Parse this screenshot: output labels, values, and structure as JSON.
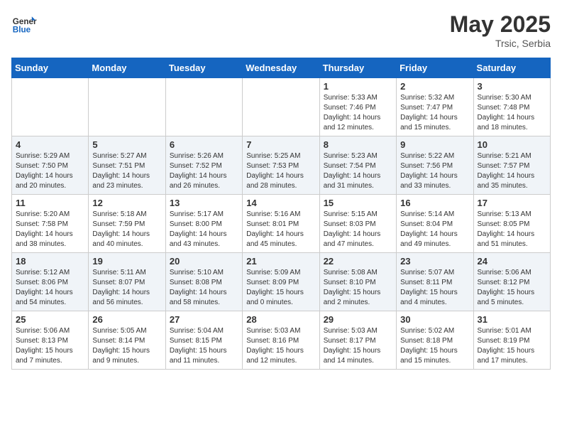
{
  "header": {
    "logo_line1": "General",
    "logo_line2": "Blue",
    "month_year": "May 2025",
    "location": "Trsic, Serbia"
  },
  "days_of_week": [
    "Sunday",
    "Monday",
    "Tuesday",
    "Wednesday",
    "Thursday",
    "Friday",
    "Saturday"
  ],
  "weeks": [
    [
      {
        "day": "",
        "info": ""
      },
      {
        "day": "",
        "info": ""
      },
      {
        "day": "",
        "info": ""
      },
      {
        "day": "",
        "info": ""
      },
      {
        "day": "1",
        "info": "Sunrise: 5:33 AM\nSunset: 7:46 PM\nDaylight: 14 hours\nand 12 minutes."
      },
      {
        "day": "2",
        "info": "Sunrise: 5:32 AM\nSunset: 7:47 PM\nDaylight: 14 hours\nand 15 minutes."
      },
      {
        "day": "3",
        "info": "Sunrise: 5:30 AM\nSunset: 7:48 PM\nDaylight: 14 hours\nand 18 minutes."
      }
    ],
    [
      {
        "day": "4",
        "info": "Sunrise: 5:29 AM\nSunset: 7:50 PM\nDaylight: 14 hours\nand 20 minutes."
      },
      {
        "day": "5",
        "info": "Sunrise: 5:27 AM\nSunset: 7:51 PM\nDaylight: 14 hours\nand 23 minutes."
      },
      {
        "day": "6",
        "info": "Sunrise: 5:26 AM\nSunset: 7:52 PM\nDaylight: 14 hours\nand 26 minutes."
      },
      {
        "day": "7",
        "info": "Sunrise: 5:25 AM\nSunset: 7:53 PM\nDaylight: 14 hours\nand 28 minutes."
      },
      {
        "day": "8",
        "info": "Sunrise: 5:23 AM\nSunset: 7:54 PM\nDaylight: 14 hours\nand 31 minutes."
      },
      {
        "day": "9",
        "info": "Sunrise: 5:22 AM\nSunset: 7:56 PM\nDaylight: 14 hours\nand 33 minutes."
      },
      {
        "day": "10",
        "info": "Sunrise: 5:21 AM\nSunset: 7:57 PM\nDaylight: 14 hours\nand 35 minutes."
      }
    ],
    [
      {
        "day": "11",
        "info": "Sunrise: 5:20 AM\nSunset: 7:58 PM\nDaylight: 14 hours\nand 38 minutes."
      },
      {
        "day": "12",
        "info": "Sunrise: 5:18 AM\nSunset: 7:59 PM\nDaylight: 14 hours\nand 40 minutes."
      },
      {
        "day": "13",
        "info": "Sunrise: 5:17 AM\nSunset: 8:00 PM\nDaylight: 14 hours\nand 43 minutes."
      },
      {
        "day": "14",
        "info": "Sunrise: 5:16 AM\nSunset: 8:01 PM\nDaylight: 14 hours\nand 45 minutes."
      },
      {
        "day": "15",
        "info": "Sunrise: 5:15 AM\nSunset: 8:03 PM\nDaylight: 14 hours\nand 47 minutes."
      },
      {
        "day": "16",
        "info": "Sunrise: 5:14 AM\nSunset: 8:04 PM\nDaylight: 14 hours\nand 49 minutes."
      },
      {
        "day": "17",
        "info": "Sunrise: 5:13 AM\nSunset: 8:05 PM\nDaylight: 14 hours\nand 51 minutes."
      }
    ],
    [
      {
        "day": "18",
        "info": "Sunrise: 5:12 AM\nSunset: 8:06 PM\nDaylight: 14 hours\nand 54 minutes."
      },
      {
        "day": "19",
        "info": "Sunrise: 5:11 AM\nSunset: 8:07 PM\nDaylight: 14 hours\nand 56 minutes."
      },
      {
        "day": "20",
        "info": "Sunrise: 5:10 AM\nSunset: 8:08 PM\nDaylight: 14 hours\nand 58 minutes."
      },
      {
        "day": "21",
        "info": "Sunrise: 5:09 AM\nSunset: 8:09 PM\nDaylight: 15 hours\nand 0 minutes."
      },
      {
        "day": "22",
        "info": "Sunrise: 5:08 AM\nSunset: 8:10 PM\nDaylight: 15 hours\nand 2 minutes."
      },
      {
        "day": "23",
        "info": "Sunrise: 5:07 AM\nSunset: 8:11 PM\nDaylight: 15 hours\nand 4 minutes."
      },
      {
        "day": "24",
        "info": "Sunrise: 5:06 AM\nSunset: 8:12 PM\nDaylight: 15 hours\nand 5 minutes."
      }
    ],
    [
      {
        "day": "25",
        "info": "Sunrise: 5:06 AM\nSunset: 8:13 PM\nDaylight: 15 hours\nand 7 minutes."
      },
      {
        "day": "26",
        "info": "Sunrise: 5:05 AM\nSunset: 8:14 PM\nDaylight: 15 hours\nand 9 minutes."
      },
      {
        "day": "27",
        "info": "Sunrise: 5:04 AM\nSunset: 8:15 PM\nDaylight: 15 hours\nand 11 minutes."
      },
      {
        "day": "28",
        "info": "Sunrise: 5:03 AM\nSunset: 8:16 PM\nDaylight: 15 hours\nand 12 minutes."
      },
      {
        "day": "29",
        "info": "Sunrise: 5:03 AM\nSunset: 8:17 PM\nDaylight: 15 hours\nand 14 minutes."
      },
      {
        "day": "30",
        "info": "Sunrise: 5:02 AM\nSunset: 8:18 PM\nDaylight: 15 hours\nand 15 minutes."
      },
      {
        "day": "31",
        "info": "Sunrise: 5:01 AM\nSunset: 8:19 PM\nDaylight: 15 hours\nand 17 minutes."
      }
    ]
  ]
}
